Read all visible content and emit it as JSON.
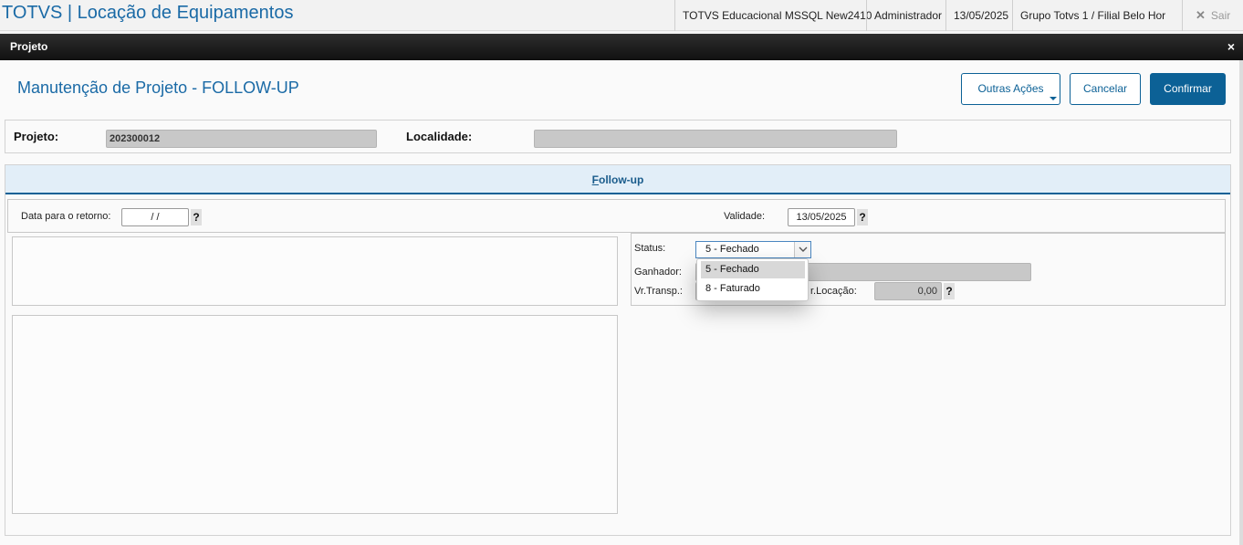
{
  "topbar": {
    "app_title": "TOTVS | Locação de Equipamentos",
    "environment": "TOTVS Educacional MSSQL New2410",
    "user": "Administrador",
    "date": "13/05/2025",
    "branch": "Grupo Totvs 1 / Filial Belo Hor",
    "exit_label": "Sair",
    "exit_icon": "close-icon"
  },
  "dialog": {
    "title": "Projeto",
    "close_glyph": "×",
    "page_title": "Manutenção de Projeto - FOLLOW-UP",
    "buttons": {
      "other_actions": "Outras Ações",
      "cancel": "Cancelar",
      "confirm": "Confirmar"
    },
    "header": {
      "project_label": "Projeto:",
      "project_value": "202300012",
      "location_label": "Localidade:",
      "location_value": ""
    },
    "followup": {
      "tab_label_first": "F",
      "tab_label_rest": "ollow-up",
      "return_date_label": "Data para o retorno:",
      "return_date_value": "/ /",
      "validity_label": "Validade:",
      "validity_value": "13/05/2025",
      "help_glyph": "?",
      "status_label": "Status:",
      "status_value": "5 - Fechado",
      "status_options": [
        "5 - Fechado",
        "8 - Faturado"
      ],
      "winner_label": "Ganhador:",
      "winner_value": "",
      "transport_label": "Vr.Transp.:",
      "rental_label": "r.Locação:",
      "rental_value": "0,00"
    }
  },
  "colors": {
    "accent": "#0c6196",
    "title_blue": "#1a6aa6",
    "tab_bg": "#e2eef8"
  }
}
